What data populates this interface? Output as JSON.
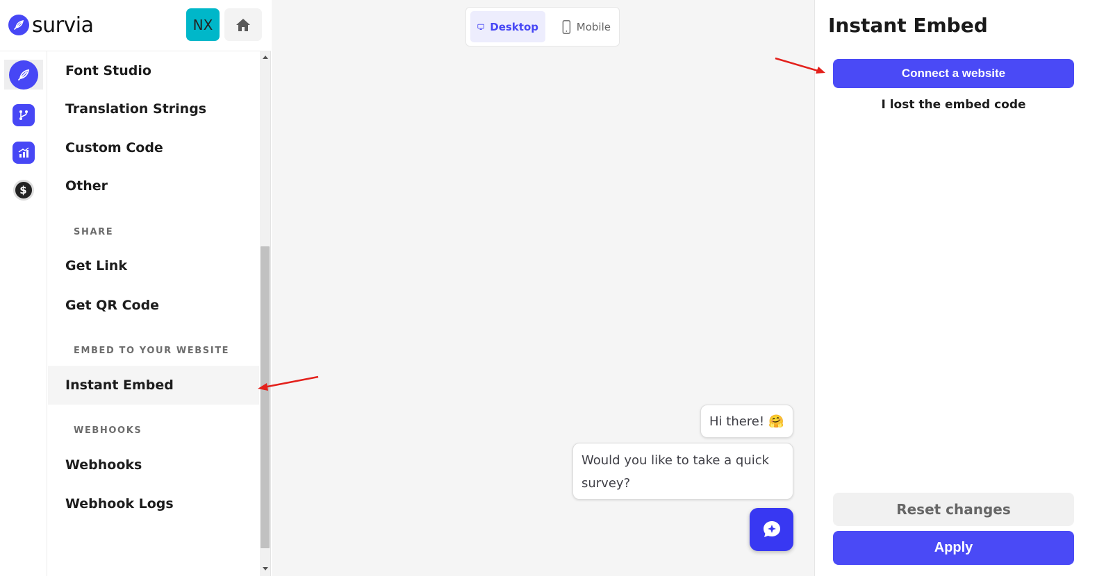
{
  "header": {
    "logo_text": "survia",
    "avatar_initials": "NX",
    "home_icon": "home-icon"
  },
  "rail": {
    "items": [
      {
        "icon": "feather-icon",
        "active": true
      },
      {
        "icon": "branch-icon",
        "active": false
      },
      {
        "icon": "chart-icon",
        "active": false
      },
      {
        "icon": "dollar-icon",
        "active": false
      }
    ]
  },
  "sidebar": {
    "items": [
      {
        "label": "Font Studio"
      },
      {
        "label": "Translation Strings"
      },
      {
        "label": "Custom Code"
      },
      {
        "label": "Other"
      }
    ],
    "share_heading": "SHARE",
    "share_items": [
      {
        "label": "Get Link"
      },
      {
        "label": "Get QR Code"
      }
    ],
    "embed_heading": "EMBED TO YOUR WEBSITE",
    "embed_items": [
      {
        "label": "Instant Embed",
        "active": true
      }
    ],
    "webhooks_heading": "WEBHOOKS",
    "webhooks_items": [
      {
        "label": "Webhooks"
      },
      {
        "label": "Webhook Logs"
      }
    ]
  },
  "preview": {
    "device_desktop": "Desktop",
    "device_mobile": "Mobile",
    "selected_device": "Desktop",
    "greeting": "Hi there!",
    "greeting_emoji": "🤗",
    "question": "Would you like to take a quick survey?"
  },
  "panel": {
    "title": "Instant Embed",
    "connect_label": "Connect a website",
    "lost_label": "I lost the embed code",
    "reset_label": "Reset changes",
    "apply_label": "Apply"
  },
  "colors": {
    "accent": "#4a4af6",
    "avatar_bg": "#00b7c9",
    "annotation_arrow": "#e3201b"
  }
}
